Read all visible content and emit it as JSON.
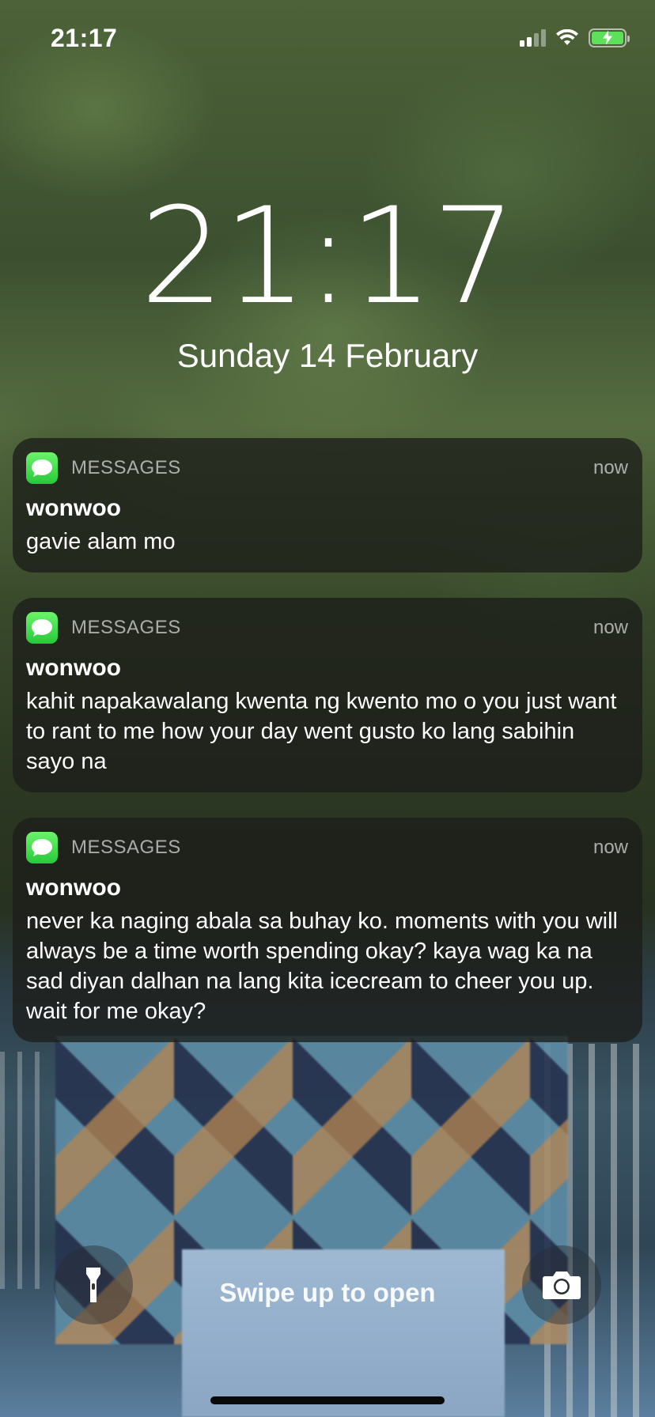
{
  "status_bar": {
    "time": "21:17",
    "battery_color": "#5ee05a"
  },
  "lock_screen": {
    "time": "21:17",
    "date": "Sunday 14 February"
  },
  "notifications": [
    {
      "app": "MESSAGES",
      "time": "now",
      "sender": "wonwoo",
      "message": "gavie alam mo",
      "icon": "messages-icon"
    },
    {
      "app": "MESSAGES",
      "time": "now",
      "sender": "wonwoo",
      "message": "kahit napakawalang kwenta ng kwento mo o you just want to rant to me how your day went gusto ko lang sabihin sayo na",
      "icon": "messages-icon"
    },
    {
      "app": "MESSAGES",
      "time": "now",
      "sender": "wonwoo",
      "message": "never ka naging abala sa buhay ko. moments with you will always be a time worth spending okay? kaya wag ka na sad diyan dalhan na lang kita icecream to cheer you up. wait for me okay?",
      "icon": "messages-icon"
    }
  ],
  "bottom": {
    "swipe_text": "Swipe up to open",
    "left_icon": "flashlight-icon",
    "right_icon": "camera-icon"
  },
  "colors": {
    "messages_green": "#34c759",
    "notification_bg": "rgba(28,30,26,0.78)"
  }
}
